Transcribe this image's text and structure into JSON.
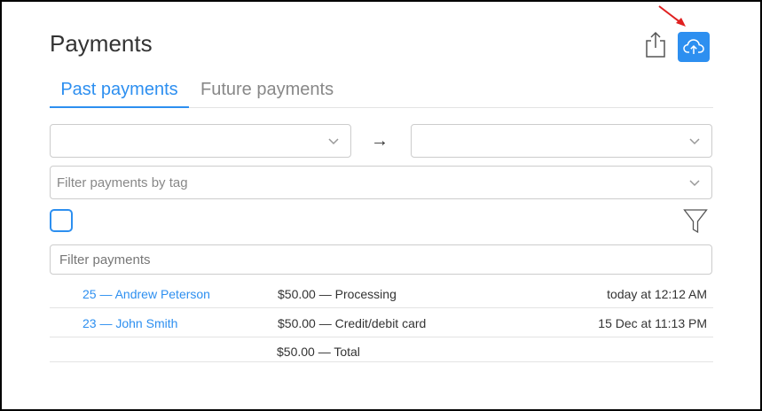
{
  "page": {
    "title": "Payments"
  },
  "toolbar": {
    "share_icon": "share-icon",
    "upload_icon": "cloud-upload-icon",
    "accent": "#2d8ff0"
  },
  "tabs": [
    {
      "label": "Past payments",
      "active": true
    },
    {
      "label": "Future payments",
      "active": false
    }
  ],
  "filters": {
    "date_from": "",
    "date_to": "",
    "range_arrow": "→",
    "tag_placeholder": "Filter payments by tag",
    "search_placeholder": "Filter payments"
  },
  "payments": [
    {
      "name": "25 — Andrew Peterson",
      "amount": "$50.00 — Processing",
      "date": "today at 12:12 AM"
    },
    {
      "name": "23 — John Smith",
      "amount": "$50.00 — Credit/debit card",
      "date": "15 Dec at 11:13 PM"
    }
  ],
  "total": {
    "label": "$50.00 — Total"
  }
}
